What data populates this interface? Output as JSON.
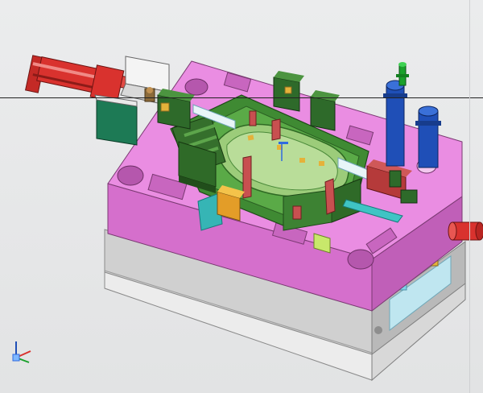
{
  "viewport": {
    "background": "#e7e8e9",
    "scene": "injection-mold-assembly"
  },
  "colors": {
    "base_plate": "#d6d6d6",
    "clamp_plate": "#f2f2f2",
    "a_plate": "#e27ed8",
    "core_insert": "#4b9a3c",
    "slider": "#3b7b32",
    "cylinder_red": "#d9322e",
    "leader_pin": "#1f4fb7",
    "cool_fitting": "#1aa12b",
    "lifter": "#a83a3a",
    "wedge_yellow": "#e5b23a"
  },
  "triad": {
    "axes": [
      "X",
      "Y",
      "Z"
    ]
  }
}
